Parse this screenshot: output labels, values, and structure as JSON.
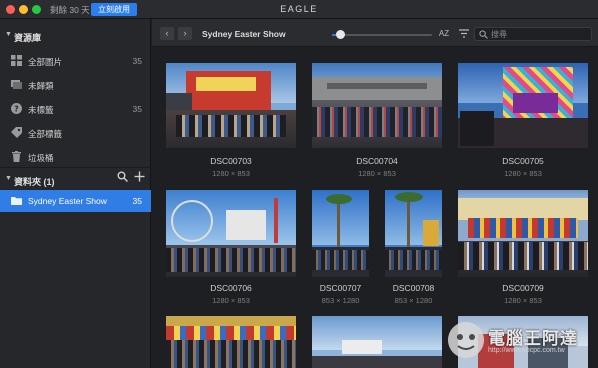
{
  "titlebar": {
    "trial_text": "剩餘 30 天",
    "buy_label": "立刻啟用",
    "app_title": "EAGLE"
  },
  "sidebar": {
    "library_header": "資源庫",
    "items": [
      {
        "label": "全部圖片",
        "count": "35",
        "icon": "grid-icon"
      },
      {
        "label": "未歸類",
        "count": "",
        "icon": "uncategorized-icon"
      },
      {
        "label": "未標籤",
        "count": "35",
        "icon": "question-icon"
      },
      {
        "label": "全部標籤",
        "count": "",
        "icon": "tag-icon"
      },
      {
        "label": "垃圾桶",
        "count": "",
        "icon": "trash-icon"
      }
    ],
    "folders_header": "資料夾 (1)",
    "folders": [
      {
        "label": "Sydney Easter Show",
        "count": "35",
        "active": true
      }
    ]
  },
  "toolbar": {
    "folder_title": "Sydney Easter Show",
    "search_placeholder": "搜尋",
    "sort_label": "AZ",
    "zoom_level": 0.08
  },
  "grid": {
    "items": [
      {
        "name": "DSC00703",
        "size": "1280 × 853"
      },
      {
        "name": "DSC00704",
        "size": "1280 × 853"
      },
      {
        "name": "DSC00705",
        "size": "1280 × 853"
      },
      {
        "name": "DSC00706",
        "size": "1280 × 853"
      },
      {
        "name": "DSC00707",
        "size": "853 × 1280"
      },
      {
        "name": "DSC00708",
        "size": "853 × 1280"
      },
      {
        "name": "DSC00709",
        "size": "1280 × 853"
      }
    ]
  },
  "watermark": {
    "text": "電腦王阿達",
    "url": "http://www.kocpc.com.tw"
  },
  "colors": {
    "accent": "#2f7de5",
    "sidebar_bg": "#26272b",
    "content_bg": "#1e1f22"
  }
}
